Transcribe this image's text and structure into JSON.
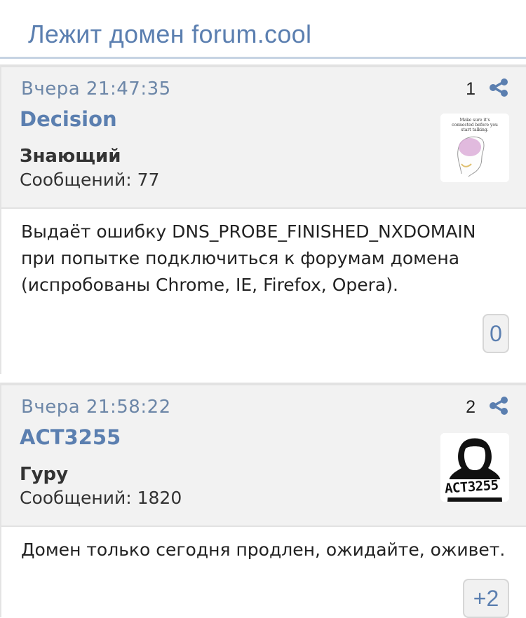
{
  "thread": {
    "title": "Лежит домен forum.cool"
  },
  "posts": [
    {
      "date": "Вчера 21:47:35",
      "number": "1",
      "author": "Decision",
      "rank": "Знающий",
      "messages": "Сообщений: 77",
      "avatar_text": "Make sure it's connected before you start talking.",
      "body": "Выдаёт ошибку DNS_PROBE_FINISHED_NXDOMAIN при попытке подключиться к форумам домена (испробованы Chrome, IE, Firefox, Opera).",
      "rating": "0"
    },
    {
      "date": "Вчера 21:58:22",
      "number": "2",
      "author": "ACT3255",
      "rank": "Гуру",
      "messages": "Сообщений: 1820",
      "avatar_text": "ACT3255",
      "body": "Домен только сегодня продлен, ожидайте, оживет.",
      "rating": "+2"
    }
  ],
  "colors": {
    "accent": "#5b7fb0",
    "header_bg": "#f2f2f2",
    "date": "#6d87a8"
  }
}
